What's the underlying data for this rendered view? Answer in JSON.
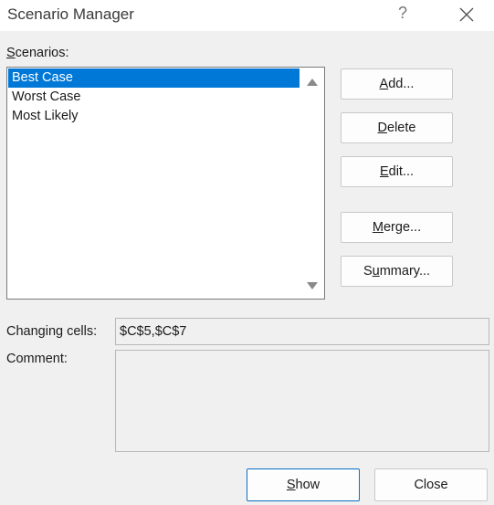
{
  "window": {
    "title": "Scenario Manager",
    "help_glyph": "?"
  },
  "scenarios": {
    "label_pre": "",
    "label_key": "S",
    "label_post": "cenarios:",
    "items": [
      "Best Case",
      "Worst Case",
      "Most Likely"
    ],
    "selected": "Best Case"
  },
  "buttons": {
    "add": {
      "pre": "",
      "key": "A",
      "post": "dd..."
    },
    "delete": {
      "pre": "",
      "key": "D",
      "post": "elete"
    },
    "edit": {
      "pre": "",
      "key": "E",
      "post": "dit..."
    },
    "merge": {
      "pre": "",
      "key": "M",
      "post": "erge..."
    },
    "summary": {
      "pre": "S",
      "key": "u",
      "post": "mmary..."
    },
    "show": {
      "pre": "",
      "key": "S",
      "post": "how"
    },
    "close": {
      "label": "Close"
    }
  },
  "changing_cells": {
    "label": "Changing cells:",
    "value": "$C$5,$C$7"
  },
  "comment": {
    "label": "Comment:",
    "value": ""
  },
  "colors": {
    "selection": "#0078d7",
    "default_button_border": "#0a6fc4"
  }
}
